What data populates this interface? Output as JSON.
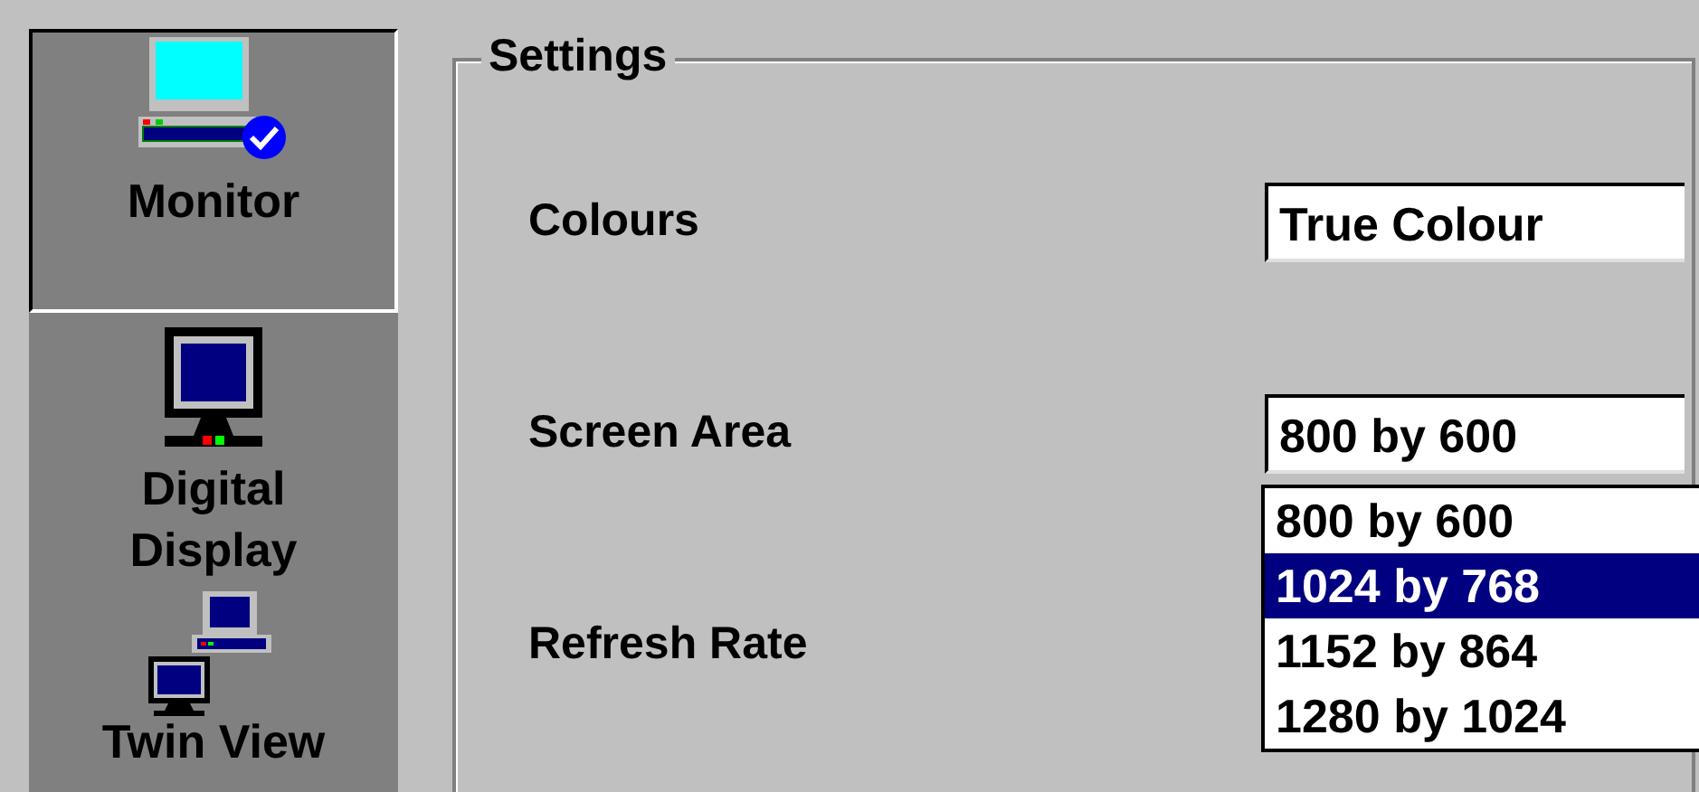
{
  "sidebar": {
    "items": [
      {
        "kind": "monitor",
        "label": "Monitor",
        "selected": true
      },
      {
        "kind": "digital",
        "label": "Digital Display",
        "selected": false
      },
      {
        "kind": "twin",
        "label": "Twin View",
        "selected": false
      }
    ]
  },
  "settings": {
    "title": "Settings",
    "rows": [
      {
        "label": "Colours",
        "value": "True Colour"
      },
      {
        "label": "Screen Area",
        "value": "800 by 600",
        "options": [
          {
            "label": "800 by 600",
            "highlighted": false
          },
          {
            "label": "1024 by 768",
            "highlighted": true
          },
          {
            "label": "1152 by 864",
            "highlighted": false
          },
          {
            "label": "1280 by 1024",
            "highlighted": false
          }
        ]
      },
      {
        "label": "Refresh Rate"
      }
    ]
  }
}
